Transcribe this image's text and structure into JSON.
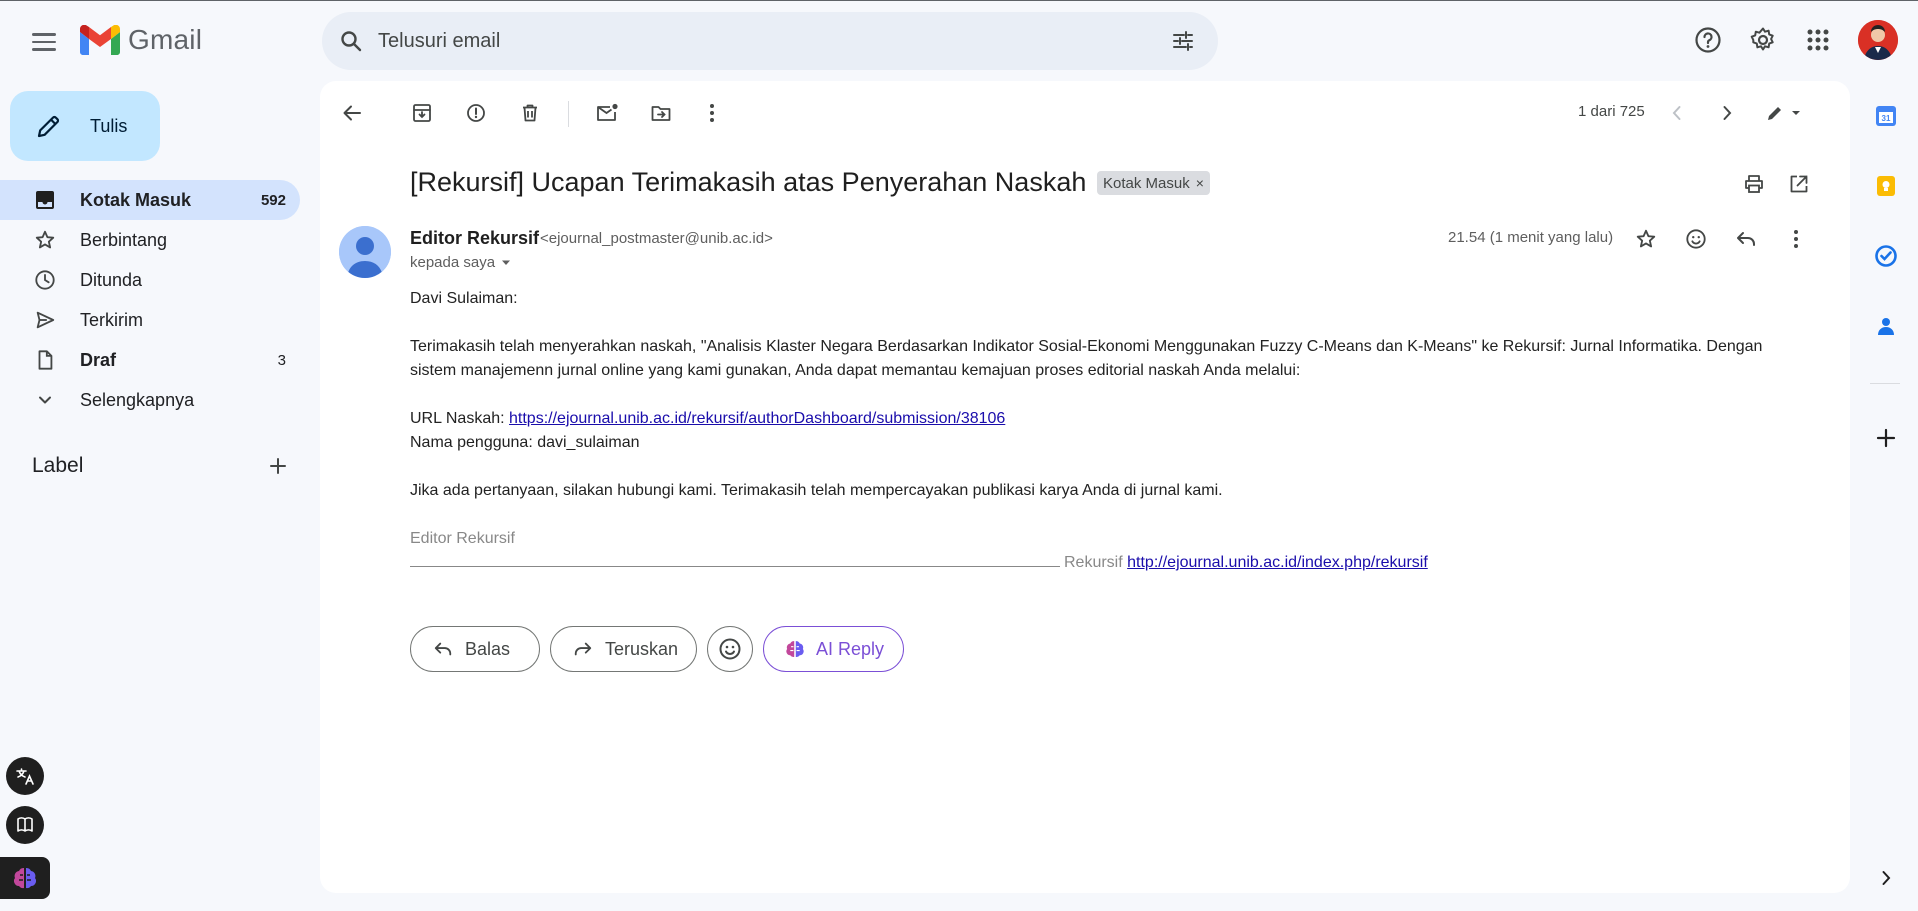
{
  "app": {
    "name": "Gmail"
  },
  "search": {
    "placeholder": "Telusuri email"
  },
  "compose": {
    "label": "Tulis"
  },
  "nav": [
    {
      "label": "Kotak Masuk",
      "count": "592"
    },
    {
      "label": "Berbintang",
      "count": ""
    },
    {
      "label": "Ditunda",
      "count": ""
    },
    {
      "label": "Terkirim",
      "count": ""
    },
    {
      "label": "Draf",
      "count": "3"
    },
    {
      "label": "Selengkapnya",
      "count": ""
    }
  ],
  "labels": {
    "title": "Label"
  },
  "toolbar": {
    "pager": "1 dari 725"
  },
  "email": {
    "subject": "[Rekursif] Ucapan Terimakasih atas Penyerahan Naskah",
    "label_chip": "Kotak Masuk",
    "sender_name": "Editor Rekursif",
    "sender_email": "<ejournal_postmaster@unib.ac.id>",
    "to": "kepada saya",
    "time": "21.54 (1 menit yang lalu)",
    "greeting": "Davi Sulaiman:",
    "para1_line1": "Terimakasih telah menyerahkan naskah, \"Analisis Klaster Negara Berdasarkan Indikator Sosial-Ekonomi Menggunakan Fuzzy C-Means dan K-Means\" ke Rekursif: Jurnal Informatika. Dengan",
    "para1_line2": "sistem manajemenn jurnal online yang kami gunakan, Anda dapat memantau kemajuan proses editorial naskah Anda melalui:",
    "url_label": "URL Naskah:",
    "url": "https://ejournal.unib.ac.id/rekursif/authorDashboard/submission/38106",
    "username_line": "Nama pengguna: davi_sulaiman",
    "closing": "Jika ada pertanyaan, silakan hubungi kami. Terimakasih telah mempercayakan publikasi karya Anda di jurnal kami.",
    "signature": "Editor Rekursif",
    "footer_label": "Rekursif",
    "footer_url": "http://ejournal.unib.ac.id/index.php/rekursif"
  },
  "actions": {
    "reply": "Balas",
    "forward": "Teruskan",
    "ai_reply": "AI Reply"
  },
  "colors": {
    "accent": "#0b57d0",
    "compose_bg": "#c2e7ff",
    "active_nav": "#d3e3fd",
    "ai_purple": "#7b4fd6"
  }
}
